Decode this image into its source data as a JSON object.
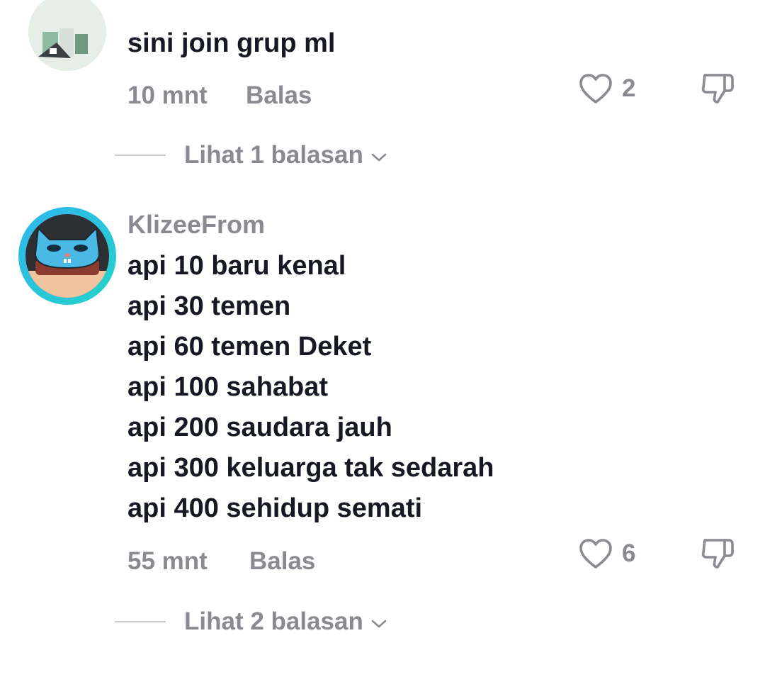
{
  "comments": [
    {
      "text": "sini join grup ml",
      "time": "10 mnt",
      "reply_label": "Balas",
      "likes": "2",
      "view_replies": "Lihat 1 balasan"
    },
    {
      "username": "KlizeeFrom",
      "lines": [
        "api 10 baru kenal",
        "api 30 temen",
        "api 60 temen Deket",
        "api 100 sahabat",
        "api 200 saudara jauh",
        "api 300 keluarga tak sedarah",
        "api 400 sehidup semati"
      ],
      "time": "55 mnt",
      "reply_label": "Balas",
      "likes": "6",
      "view_replies": "Lihat 2 balasan"
    }
  ],
  "colors": {
    "primary_text": "#161823",
    "secondary_text": "#8a8b91",
    "story_ring_start": "#2fb6f0",
    "story_ring_end": "#23d3c8"
  },
  "icons": {
    "like": "heart-outline-icon",
    "dislike": "thumbs-down-outline-icon",
    "expand": "chevron-down-icon"
  }
}
